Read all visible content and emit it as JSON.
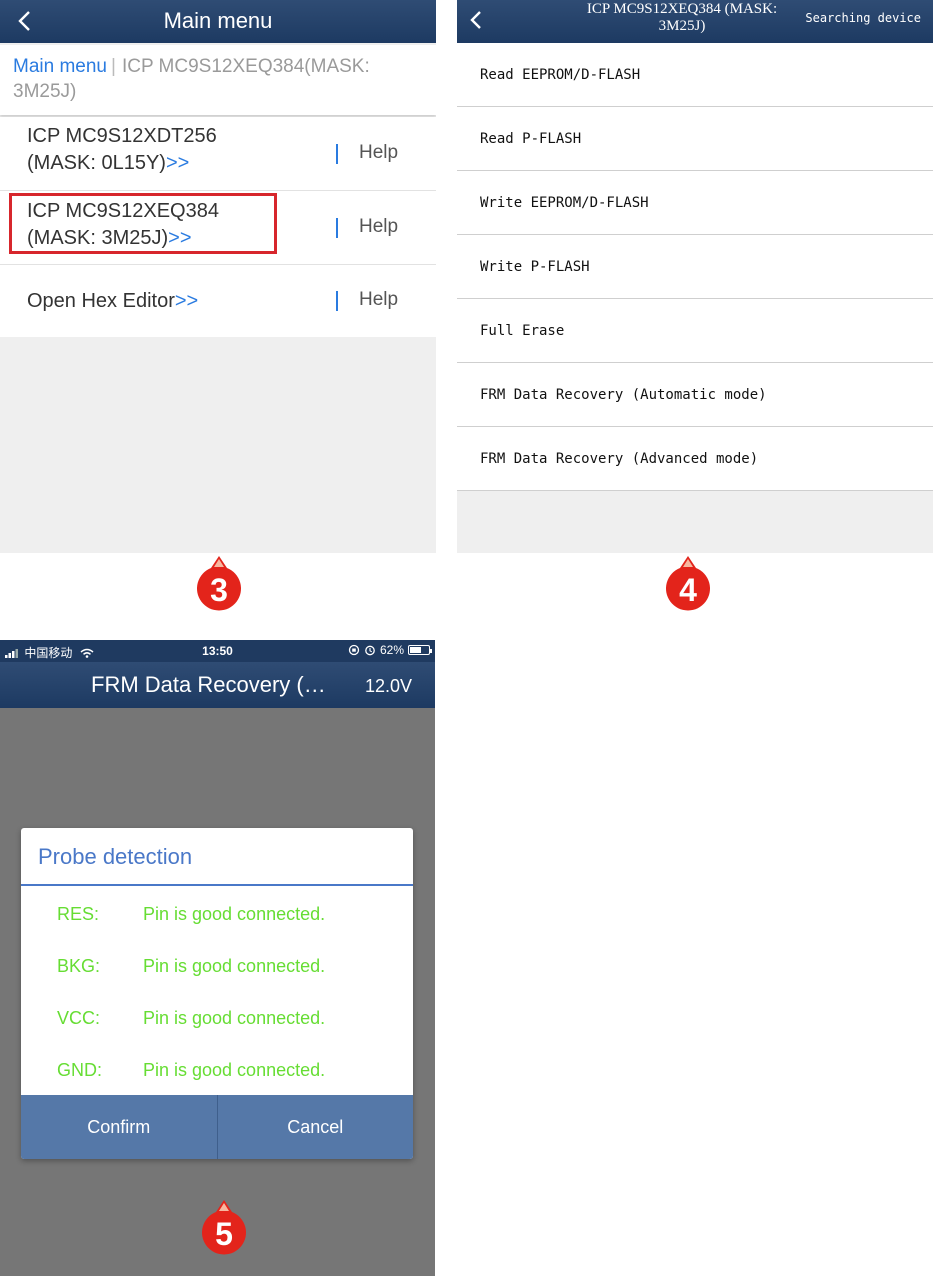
{
  "panel3": {
    "nav_title": "Main menu",
    "breadcrumb": {
      "root": "Main menu",
      "separator": "|",
      "current": "ICP MC9S12XEQ384(MASK: 3M25J)"
    },
    "items": [
      {
        "line1": "ICP MC9S12XDT256",
        "line2": "(MASK: 0L15Y)",
        "arrow": ">>",
        "help": "Help"
      },
      {
        "line1": "ICP MC9S12XEQ384",
        "line2": "(MASK: 3M25J)",
        "arrow": ">>",
        "help": "Help"
      },
      {
        "line1": "Open Hex Editor",
        "arrow": ">>",
        "help": "Help"
      }
    ],
    "step_number": "3"
  },
  "panel4": {
    "title": "ICP MC9S12XEQ384 (MASK: 3M25J)",
    "status": "Searching device",
    "items": [
      "Read EEPROM/D-FLASH",
      "Read P-FLASH",
      "Write EEPROM/D-FLASH",
      "Write P-FLASH",
      "Full Erase",
      "FRM Data Recovery (Automatic mode)",
      "FRM Data Recovery (Advanced mode)"
    ],
    "step_number": "4"
  },
  "panel5": {
    "statusbar": {
      "carrier": "中国移动",
      "time": "13:50",
      "battery": "62%",
      "battery_level": 0.62
    },
    "nav_title": "FRM Data Recovery (…",
    "voltage": "12.0V",
    "dialog": {
      "title": "Probe detection",
      "rows": [
        {
          "pin": "RES:",
          "status": "Pin is good connected."
        },
        {
          "pin": "BKG:",
          "status": "Pin is good connected."
        },
        {
          "pin": "VCC:",
          "status": "Pin is good connected."
        },
        {
          "pin": "GND:",
          "status": "Pin is good connected."
        }
      ],
      "confirm": "Confirm",
      "cancel": "Cancel"
    },
    "step_number": "5"
  },
  "colors": {
    "navbar": "#1d3a62",
    "link_blue": "#2a7be0",
    "highlight_red": "#d7262c",
    "badge_red": "#e3241b",
    "probe_green": "#66dd33",
    "dialog_button": "#5578a8"
  }
}
